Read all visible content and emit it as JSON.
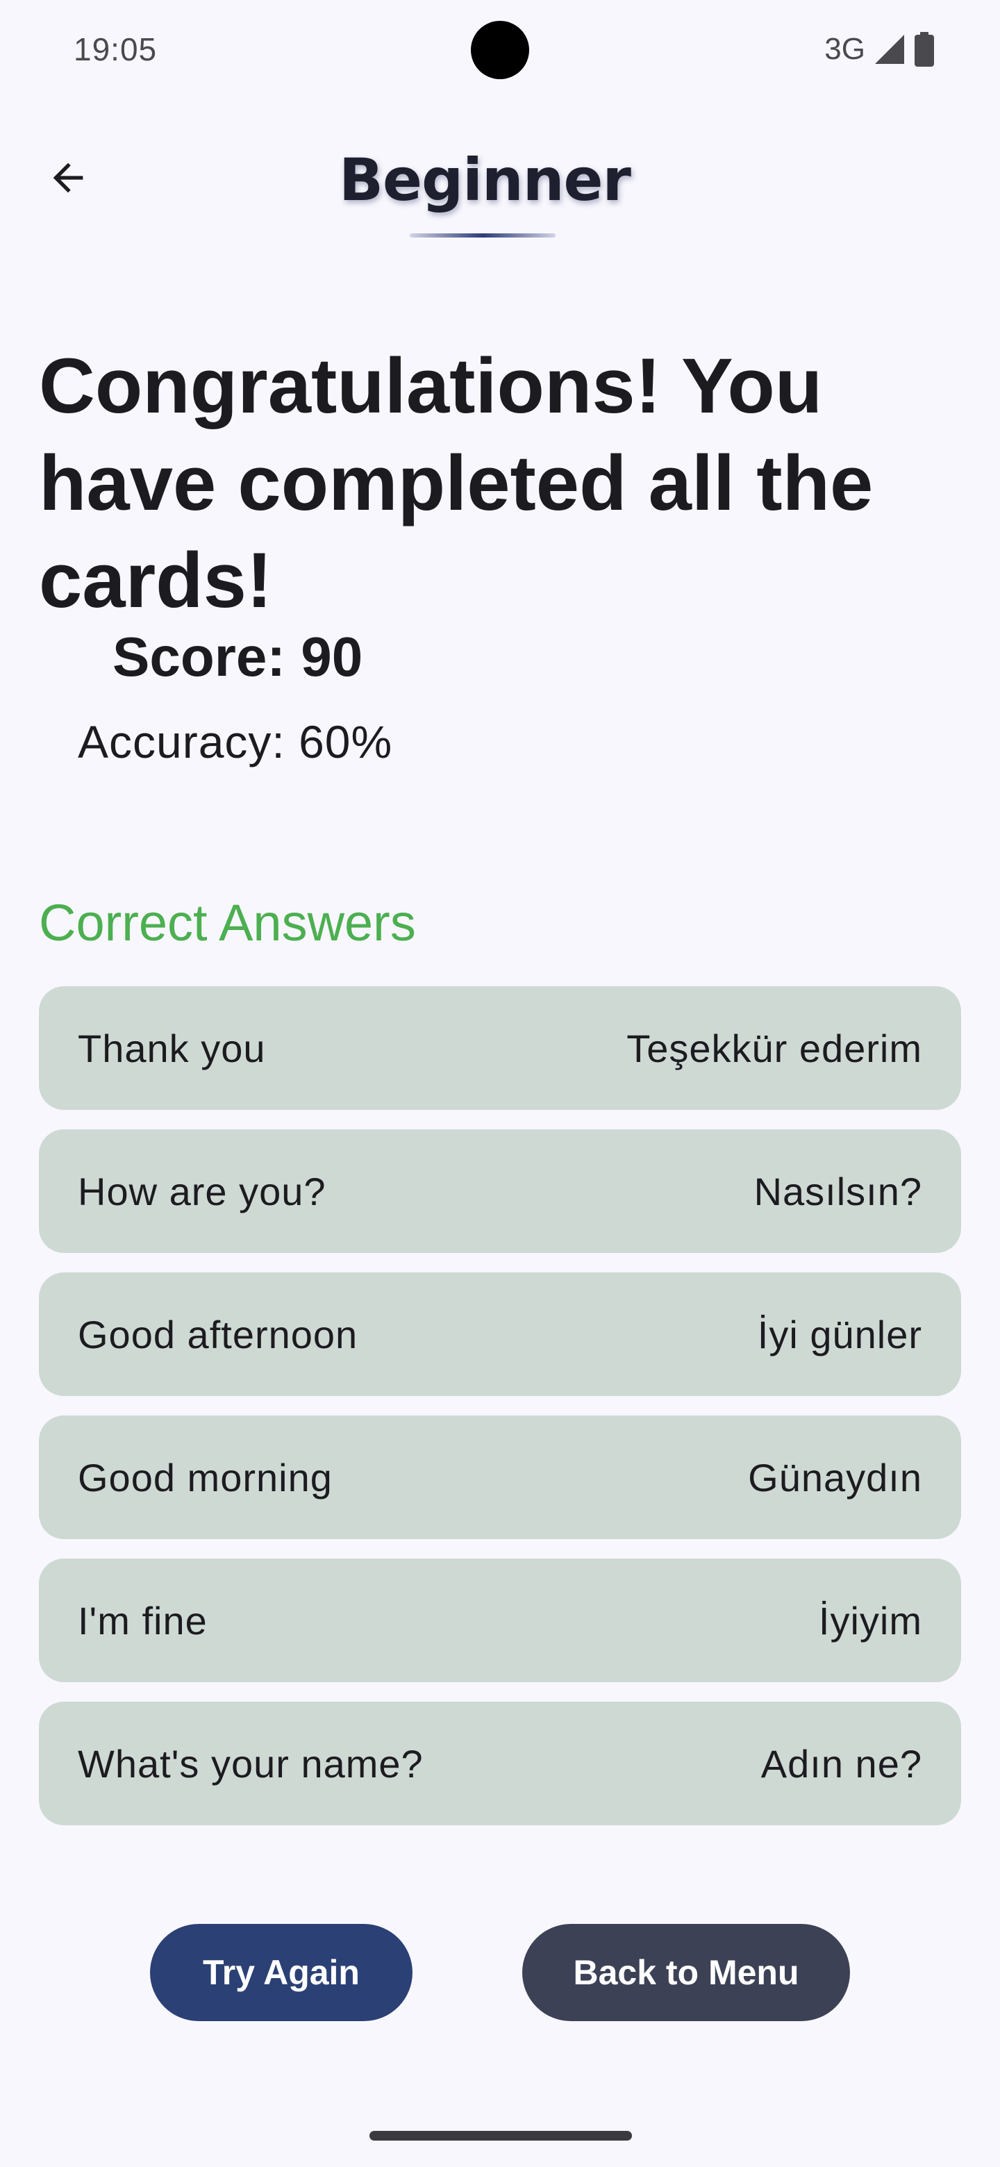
{
  "status_bar": {
    "time": "19:05",
    "network": "3G"
  },
  "header": {
    "title": "Beginner"
  },
  "result": {
    "headline": "Congratulations! You have completed all the cards!",
    "score": "Score: 90",
    "accuracy": "Accuracy: 60%"
  },
  "correct_answers": {
    "title": "Correct Answers",
    "items": [
      {
        "english": "Thank you",
        "turkish": "Teşekkür ederim"
      },
      {
        "english": "How are you?",
        "turkish": "Nasılsın?"
      },
      {
        "english": "Good afternoon",
        "turkish": "İyi günler"
      },
      {
        "english": "Good morning",
        "turkish": "Günaydın"
      },
      {
        "english": "I'm fine",
        "turkish": "İyiyim"
      },
      {
        "english": "What's your name?",
        "turkish": "Adın ne?"
      }
    ]
  },
  "actions": {
    "try_again": "Try Again",
    "back_to_menu": "Back to Menu"
  },
  "colors": {
    "accent_green": "#4caf50",
    "try_again_button": "#2b4074",
    "back_button": "#3d4156",
    "card_background": "#ced9d3"
  }
}
